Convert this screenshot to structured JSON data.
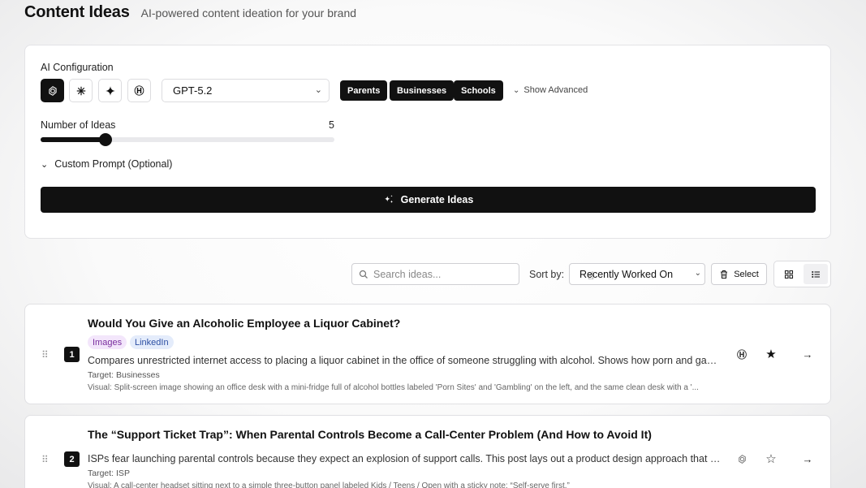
{
  "header": {
    "title": "Content Ideas",
    "subtitle": "AI-powered content ideation for your brand"
  },
  "config": {
    "label": "AI Configuration",
    "providers": [
      {
        "icon": "openai-icon",
        "active": true
      },
      {
        "icon": "claude-icon",
        "active": false
      },
      {
        "icon": "gemini-icon",
        "active": false
      },
      {
        "icon": "hf-icon",
        "active": false
      }
    ],
    "model": "GPT-5.2",
    "audiences": [
      "Parents",
      "Businesses",
      "Schools"
    ],
    "show_advanced": "Show Advanced",
    "num_ideas_label": "Number of Ideas",
    "num_ideas_value": "5",
    "num_ideas_fraction": 0.22,
    "custom_prompt": "Custom Prompt (Optional)",
    "generate": "Generate Ideas"
  },
  "toolbar": {
    "search_placeholder": "Search ideas...",
    "sort_label": "Sort by:",
    "sort_value": "Recently Worked On",
    "select_label": "Select"
  },
  "ideas": [
    {
      "number": "1",
      "title": "Would You Give an Alcoholic Employee a Liquor Cabinet?",
      "tags": [
        "Images",
        "LinkedIn"
      ],
      "description": "Compares unrestricted internet access to placing a liquor cabinet in the office of someone struggling with alcohol. Shows how porn and gamblin...",
      "target": "Target: Businesses",
      "visual": "Visual: Split-screen image showing an office desk with a mini-fridge full of alcohol bottles labeled 'Porn Sites' and 'Gambling' on the left, and the same clean desk with a '...",
      "favorite": true
    },
    {
      "number": "2",
      "title": "The “Support Ticket Trap”: When Parental Controls Become a Call-Center Problem (And How to Avoid It)",
      "tags": [],
      "description": "ISPs fear launching parental controls because they expect an explosion of support calls. This post lays out a product design approach that keeps...",
      "target": "Target: ISP",
      "visual": "Visual: A call-center headset sitting next to a simple three-button panel labeled Kids / Teens / Open with a sticky note: “Self-serve first.”",
      "favorite": false
    }
  ]
}
